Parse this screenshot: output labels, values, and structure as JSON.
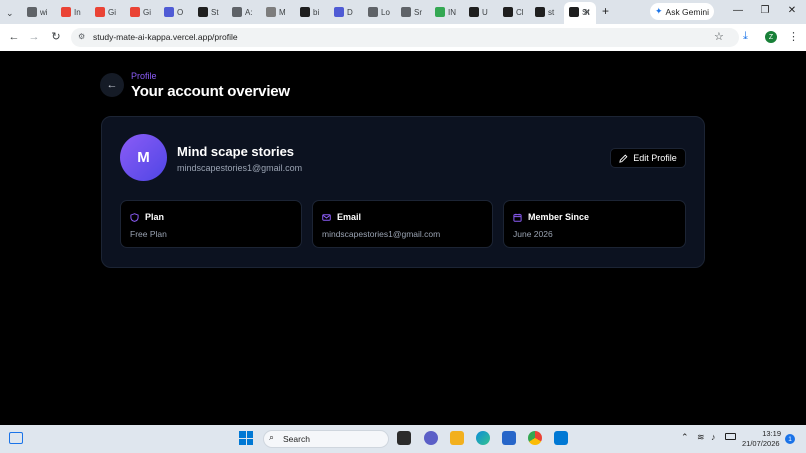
{
  "browser": {
    "tabs": [
      {
        "label": "wi",
        "icon": "globe-icon",
        "color": "#5f6368"
      },
      {
        "label": "In",
        "icon": "gmail-icon",
        "color": "#ea4335"
      },
      {
        "label": "Gi",
        "icon": "gmail-icon",
        "color": "#ea4335"
      },
      {
        "label": "Gi",
        "icon": "gmail-icon",
        "color": "#ea4335"
      },
      {
        "label": "O",
        "icon": "circle-icon",
        "color": "#4f5bd5"
      },
      {
        "label": "St",
        "icon": "github-icon",
        "color": "#1f1f1f"
      },
      {
        "label": "A:",
        "icon": "globe-icon",
        "color": "#5f6368"
      },
      {
        "label": "M",
        "icon": "shield-icon",
        "color": "#7d7d7d"
      },
      {
        "label": "bi",
        "icon": "wave-icon",
        "color": "#1f1f1f"
      },
      {
        "label": "D",
        "icon": "chat-icon",
        "color": "#4f5bd5"
      },
      {
        "label": "Lo",
        "icon": "link-icon",
        "color": "#5f6368"
      },
      {
        "label": "Sr",
        "icon": "globe-icon",
        "color": "#5f6368"
      },
      {
        "label": "IN",
        "icon": "bookmark-icon",
        "color": "#34a853"
      },
      {
        "label": "U",
        "icon": "ai-icon",
        "color": "#1f1f1f"
      },
      {
        "label": "Cl",
        "icon": "shield-icon",
        "color": "#1f1f1f"
      },
      {
        "label": "st",
        "icon": "app-icon",
        "color": "#1f1f1f"
      },
      {
        "label": "St",
        "icon": "app-icon",
        "color": "#1f1f1f"
      }
    ],
    "ask_gemini": "Ask Gemini",
    "url": "study-mate-ai-kappa.vercel.app/profile",
    "profile_initial": "Z"
  },
  "page": {
    "breadcrumb": "Profile",
    "title": "Your account overview",
    "user": {
      "initial": "M",
      "name": "Mind scape stories",
      "email": "mindscapestories1@gmail.com"
    },
    "edit_button": "Edit Profile",
    "info_cards": [
      {
        "label": "Plan",
        "value": "Free Plan",
        "icon": "shield-icon"
      },
      {
        "label": "Email",
        "value": "mindscapestories1@gmail.com",
        "icon": "mail-icon"
      },
      {
        "label": "Member Since",
        "value": "June 2026",
        "icon": "calendar-icon"
      }
    ],
    "accent_color": "#8b5cf6"
  },
  "taskbar": {
    "search_placeholder": "Search",
    "time": "13:19",
    "date": "21/07/2026",
    "notifications": "1"
  }
}
